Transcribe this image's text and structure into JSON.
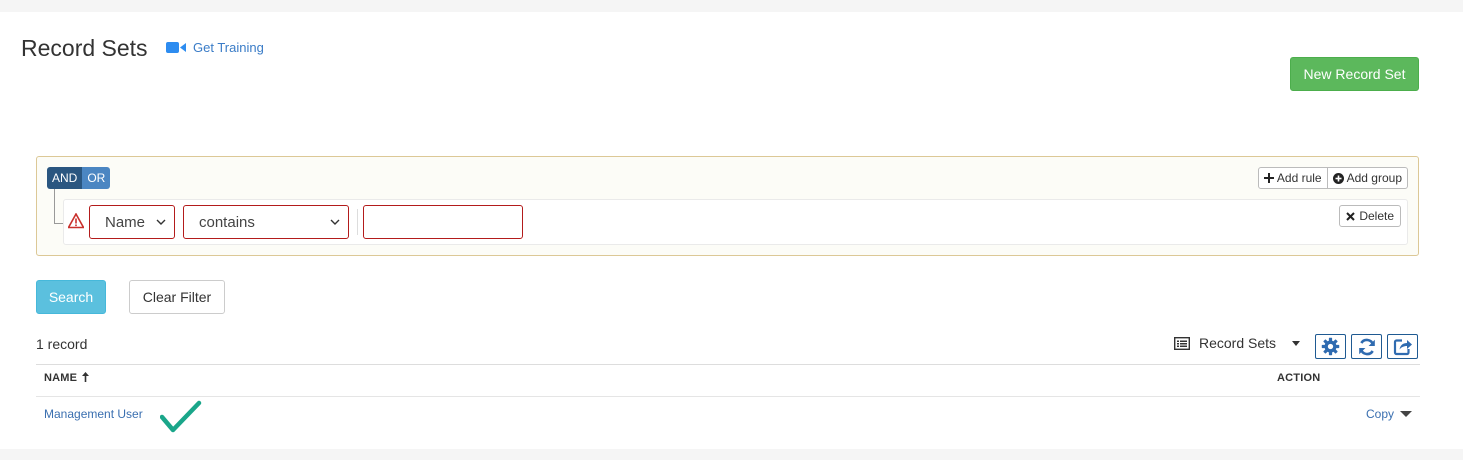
{
  "header": {
    "title": "Record Sets",
    "training_link": "Get Training",
    "new_button": "New Record Set"
  },
  "query_builder": {
    "and_label": "AND",
    "or_label": "OR",
    "add_rule": "Add rule",
    "add_group": "Add group",
    "rule": {
      "field": "Name",
      "operator": "contains",
      "value": "",
      "delete_label": "Delete"
    }
  },
  "actions": {
    "search": "Search",
    "clear_filter": "Clear Filter"
  },
  "results": {
    "count": "1 record",
    "view_selector": "Record Sets",
    "columns": {
      "name": "NAME",
      "action": "ACTION"
    },
    "rows": [
      {
        "name": "Management User",
        "action": "Copy"
      }
    ]
  },
  "colors": {
    "primary_green": "#5cb85c",
    "search_blue": "#5bc0de",
    "link_blue": "#3a6fb0",
    "error_red": "#b31b1b",
    "check_teal": "#1aa68a"
  },
  "icons": [
    "video-camera-icon",
    "plus-icon",
    "plus-circle-icon",
    "warning-icon",
    "times-icon",
    "list-icon",
    "gear-icon",
    "refresh-icon",
    "export-icon",
    "sort-up-icon",
    "checkmark-icon",
    "caret-down-icon"
  ]
}
